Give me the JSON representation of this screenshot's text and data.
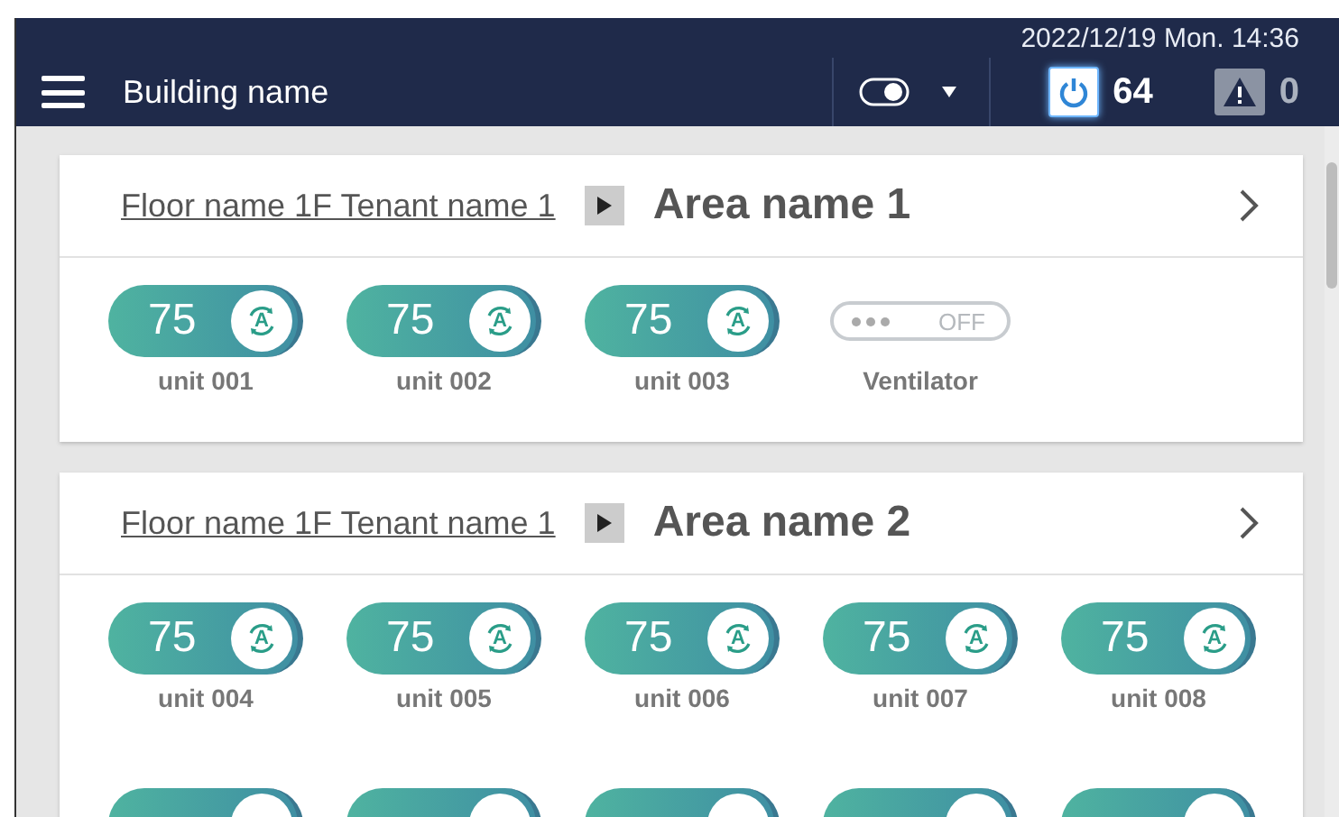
{
  "header": {
    "datetime": "2022/12/19 Mon. 14:36",
    "building": "Building name",
    "toggle_on": true,
    "power_count": "64",
    "alarm_count": "0"
  },
  "areas": [
    {
      "floor": "Floor name 1F Tenant name 1",
      "area": "Area name 1",
      "units": [
        {
          "kind": "unit",
          "value": "75",
          "mode": "A",
          "name": "unit 001"
        },
        {
          "kind": "unit",
          "value": "75",
          "mode": "A",
          "name": "unit 002"
        },
        {
          "kind": "unit",
          "value": "75",
          "mode": "A",
          "name": "unit 003"
        },
        {
          "kind": "ventilator",
          "state": "OFF",
          "on": false,
          "name": "Ventilator"
        }
      ]
    },
    {
      "floor": "Floor name 1F Tenant name 1",
      "area": "Area name 2",
      "units": [
        {
          "kind": "unit",
          "value": "75",
          "mode": "A",
          "name": "unit 004"
        },
        {
          "kind": "unit",
          "value": "75",
          "mode": "A",
          "name": "unit 005"
        },
        {
          "kind": "unit",
          "value": "75",
          "mode": "A",
          "name": "unit 006"
        },
        {
          "kind": "unit",
          "value": "75",
          "mode": "A",
          "name": "unit 007"
        },
        {
          "kind": "unit",
          "value": "75",
          "mode": "A",
          "name": "unit 008"
        },
        {
          "kind": "unit_partial"
        },
        {
          "kind": "unit_partial"
        },
        {
          "kind": "unit_partial"
        },
        {
          "kind": "unit_partial"
        },
        {
          "kind": "unit_partial"
        }
      ]
    }
  ]
}
